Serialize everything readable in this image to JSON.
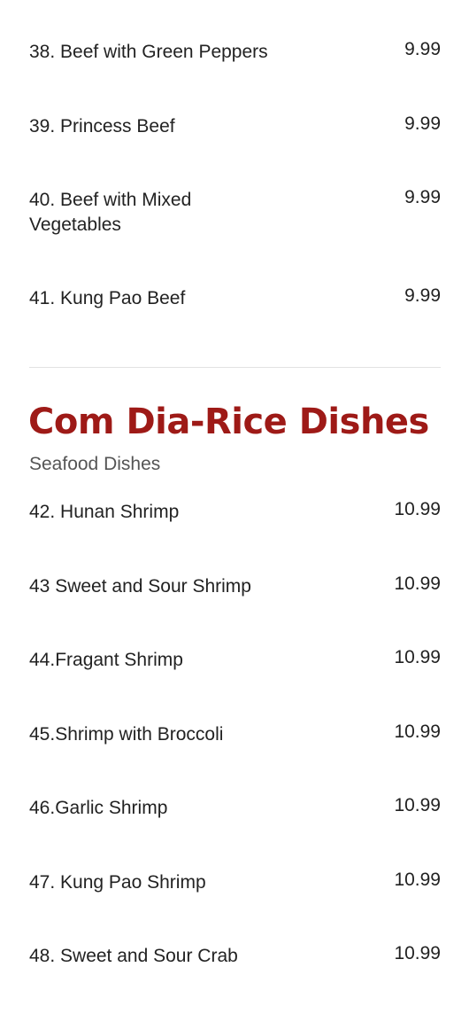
{
  "beef_items": [
    {
      "name": "38. Beef with Green Peppers",
      "price": "9.99"
    },
    {
      "name": "39. Princess Beef",
      "price": "9.99"
    },
    {
      "name": "40. Beef with Mixed Vegetables",
      "price": "9.99"
    },
    {
      "name": "41. Kung Pao Beef",
      "price": "9.99"
    }
  ],
  "rice_section": {
    "title": "Com Dia-Rice Dishes",
    "subtitle": "Seafood Dishes",
    "title_color": "#9e1a17"
  },
  "seafood_items": [
    {
      "name": "42. Hunan Shrimp",
      "price": "10.99"
    },
    {
      "name": "43 Sweet and Sour Shrimp",
      "price": "10.99"
    },
    {
      "name": "44.Fragant Shrimp",
      "price": "10.99"
    },
    {
      "name": "45.Shrimp with Broccoli",
      "price": "10.99"
    },
    {
      "name": "46.Garlic Shrimp",
      "price": "10.99"
    },
    {
      "name": "47. Kung Pao Shrimp",
      "price": "10.99"
    },
    {
      "name": "48. Sweet and Sour Crab",
      "price": "10.99"
    }
  ]
}
